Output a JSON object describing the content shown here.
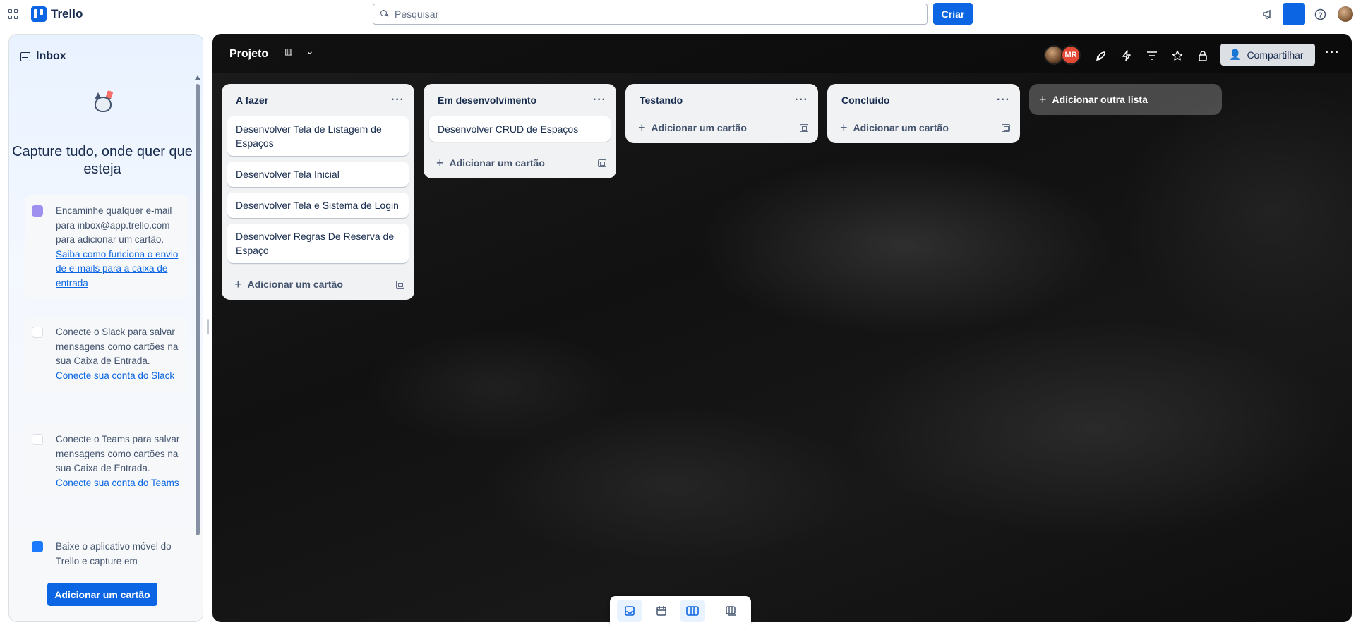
{
  "topbar": {
    "app_name": "Trello",
    "search_placeholder": "Pesquisar",
    "create_label": "Criar"
  },
  "inbox": {
    "title": "Inbox",
    "heading": "Capture tudo, onde quer que esteja",
    "tips": [
      {
        "icon": "email-icon",
        "color": "#9f8fef",
        "text": "Encaminhe qualquer e-mail para inbox@app.trello.com para adicionar um cartão.",
        "link": "Saiba como funciona o envio de e-mails para a caixa de entrada"
      },
      {
        "icon": "slack-icon",
        "color": "#ffffff",
        "text": "Conecte o Slack para salvar mensagens como cartões na sua Caixa de Entrada.",
        "link": "Conecte sua conta do Slack"
      },
      {
        "icon": "teams-icon",
        "color": "#ffffff",
        "text": "Conecte o Teams para salvar mensagens como cartões na sua Caixa de Entrada.",
        "link": "Conecte sua conta do Teams"
      },
      {
        "icon": "mobile-icon",
        "color": "#1d7afc",
        "text": "Baixe o aplicativo móvel do Trello e capture em",
        "link": ""
      }
    ],
    "add_card_label": "Adicionar um cartão"
  },
  "board": {
    "title": "Projeto",
    "member_initials": "MR",
    "share_label": "Compartilhar",
    "add_list_label": "Adicionar outra lista",
    "lists": [
      {
        "title": "A fazer",
        "cards": [
          "Desenvolver Tela de Listagem de Espaços",
          "Desenvolver Tela Inicial",
          "Desenvolver Tela e Sistema de Login",
          "Desenvolver Regras De Reserva de Espaço"
        ],
        "add_label": "Adicionar um cartão"
      },
      {
        "title": "Em desenvolvimento",
        "cards": [
          "Desenvolver CRUD de Espaços"
        ],
        "add_label": "Adicionar um cartão"
      },
      {
        "title": "Testando",
        "cards": [],
        "add_label": "Adicionar um cartão"
      },
      {
        "title": "Concluído",
        "cards": [],
        "add_label": "Adicionar um cartão"
      }
    ]
  },
  "colors": {
    "accent": "#0c66e4",
    "board_background": "#141414",
    "list_background": "#f1f2f4"
  }
}
